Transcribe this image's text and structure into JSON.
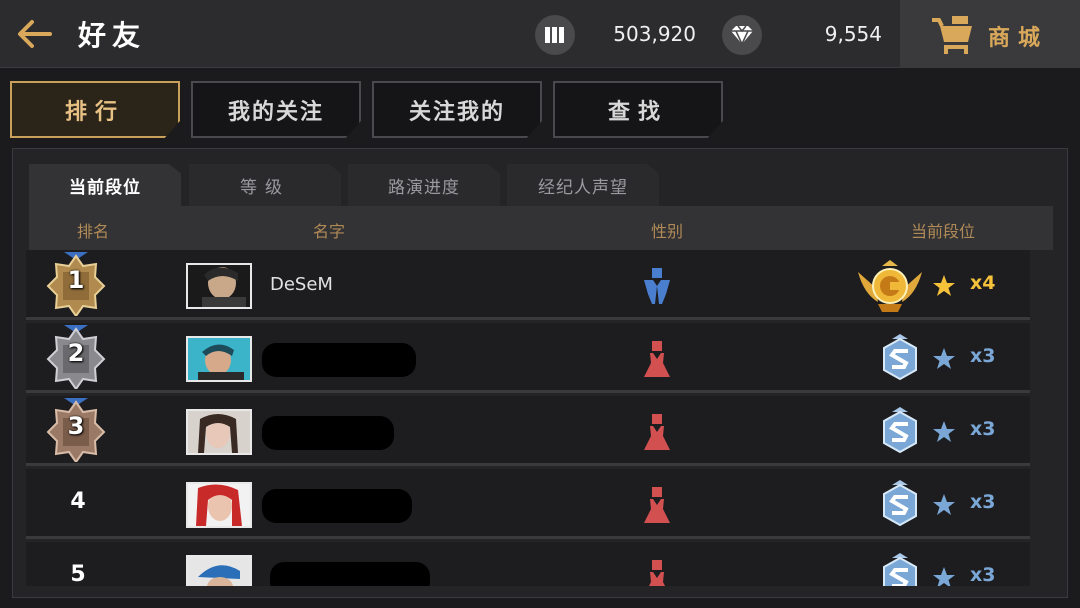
{
  "header": {
    "title": "好友",
    "coins": "503,920",
    "diamonds": "9,554",
    "shop_label": "商城"
  },
  "main_tabs": [
    {
      "label": "排行",
      "active": true
    },
    {
      "label": "我的关注",
      "active": false
    },
    {
      "label": "关注我的",
      "active": false
    },
    {
      "label": "查找",
      "active": false
    }
  ],
  "sub_tabs": [
    {
      "label": "当前段位",
      "active": true
    },
    {
      "label": "等级",
      "active": false
    },
    {
      "label": "路演进度",
      "active": false
    },
    {
      "label": "经纪人声望",
      "active": false
    }
  ],
  "table": {
    "columns": [
      "排名",
      "名字",
      "性别",
      "当前段位"
    ],
    "rows": [
      {
        "rank": "1",
        "name": "DeSeM",
        "gender": "male",
        "tier": "gold",
        "stars": "x4"
      },
      {
        "rank": "2",
        "name": "",
        "gender": "female",
        "tier": "silver",
        "stars": "x3"
      },
      {
        "rank": "3",
        "name": "",
        "gender": "female",
        "tier": "silver",
        "stars": "x3"
      },
      {
        "rank": "4",
        "name": "",
        "gender": "female",
        "tier": "silver",
        "stars": "x3"
      },
      {
        "rank": "5",
        "name": "",
        "gender": "female",
        "tier": "silver",
        "stars": "x3"
      }
    ]
  },
  "colors": {
    "accent_gold": "#c9a05a",
    "male_blue": "#4a7fd0",
    "female_red": "#d25050",
    "silver_blue": "#7aa7d6",
    "gold_star": "#f5c23a"
  },
  "icons": {
    "back": "arrow-left-icon",
    "coins": "coin-bars-icon",
    "diamond": "diamond-icon",
    "shop": "cart-icon"
  }
}
